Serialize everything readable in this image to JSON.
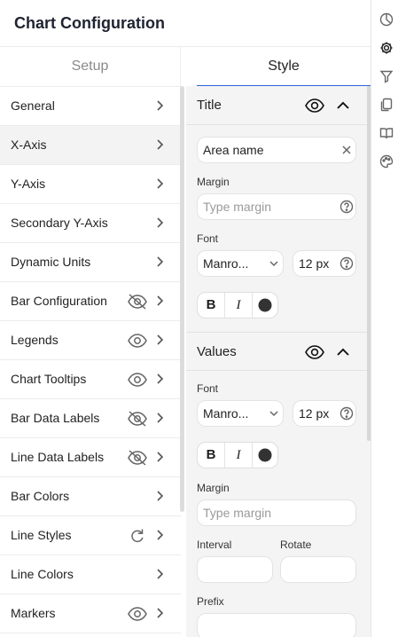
{
  "header": {
    "title": "Chart Configuration"
  },
  "tabs": [
    {
      "label": "Setup"
    },
    {
      "label": "Style"
    }
  ],
  "left_list": [
    {
      "label": "General"
    },
    {
      "label": "X-Axis"
    },
    {
      "label": "Y-Axis"
    },
    {
      "label": "Secondary Y-Axis"
    },
    {
      "label": "Dynamic Units"
    },
    {
      "label": "Bar Configuration",
      "toggle_icon": "eye-off-icon"
    },
    {
      "label": "Legends",
      "toggle_icon": "eye-icon"
    },
    {
      "label": "Chart Tooltips",
      "toggle_icon": "eye-icon"
    },
    {
      "label": "Bar Data Labels",
      "toggle_icon": "eye-off-icon"
    },
    {
      "label": "Line Data Labels",
      "toggle_icon": "eye-off-icon"
    },
    {
      "label": "Bar Colors"
    },
    {
      "label": "Line Styles",
      "toggle_icon": "refresh-icon"
    },
    {
      "label": "Line Colors"
    },
    {
      "label": "Markers",
      "toggle_icon": "eye-icon"
    }
  ],
  "title_section": {
    "heading": "Title",
    "name_value": "Area name",
    "margin_label": "Margin",
    "margin_placeholder": "Type margin",
    "font_label": "Font",
    "font_family": "Manro...",
    "font_size": "12 px",
    "bold": "B",
    "italic": "I"
  },
  "values_section": {
    "heading": "Values",
    "font_label": "Font",
    "font_family": "Manro...",
    "font_size": "12 px",
    "bold": "B",
    "italic": "I",
    "margin_label": "Margin",
    "margin_placeholder": "Type margin",
    "interval_label": "Interval",
    "rotate_label": "Rotate",
    "prefix_label": "Prefix"
  }
}
